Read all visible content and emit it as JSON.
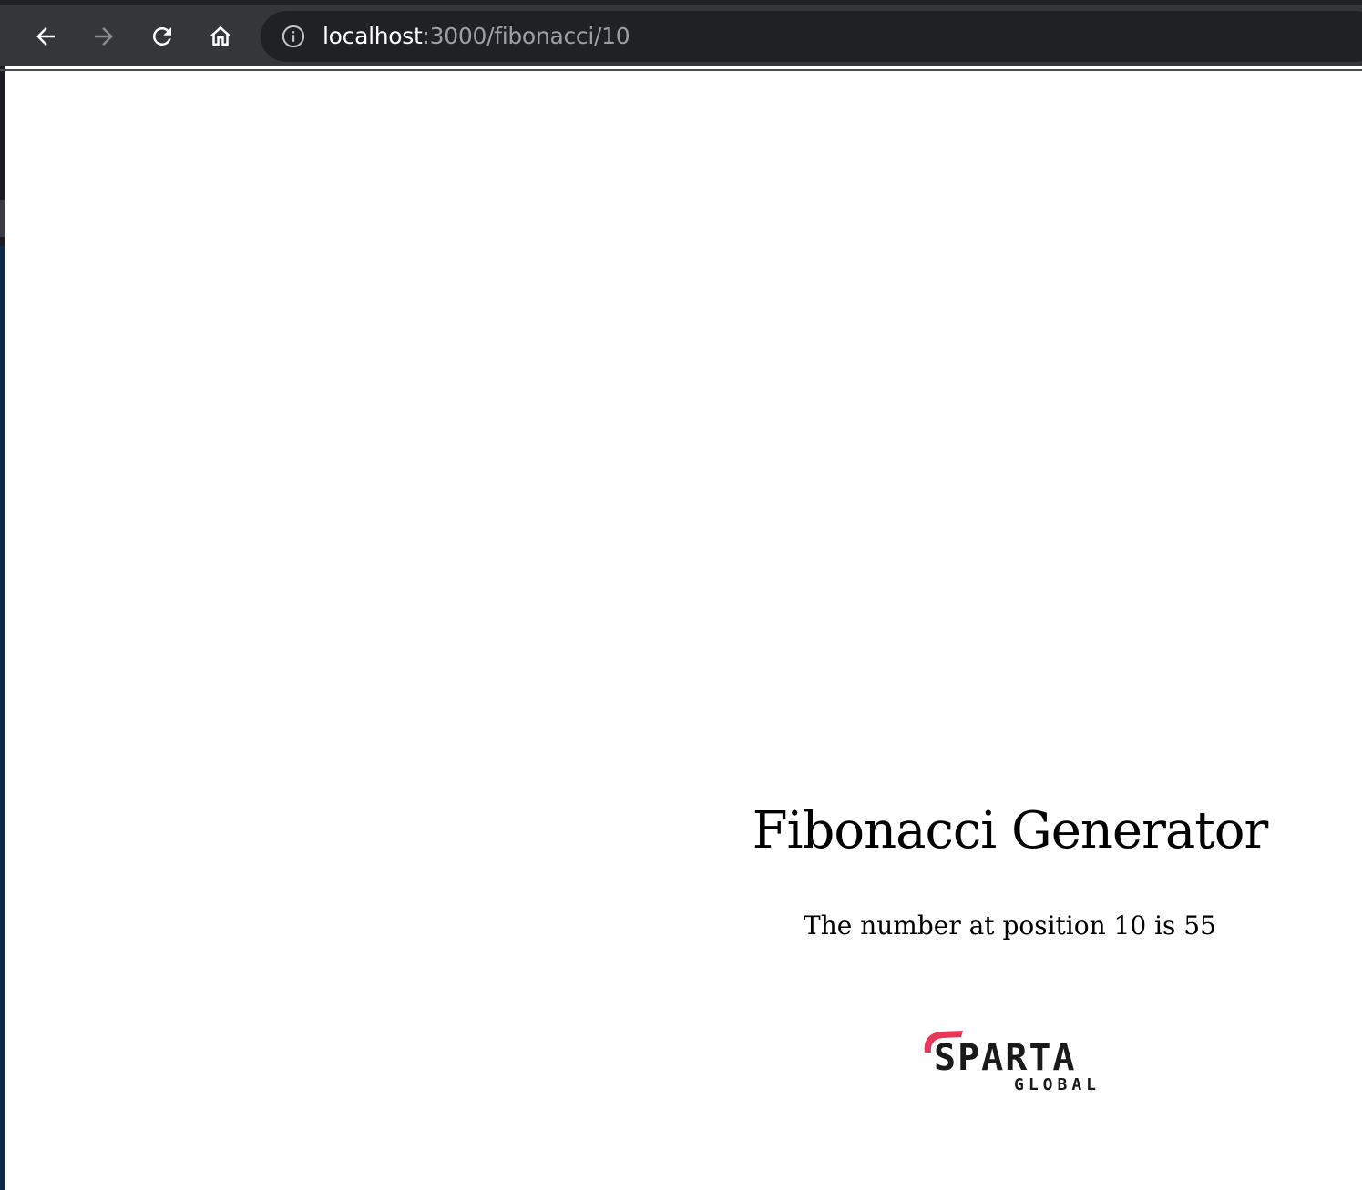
{
  "browser": {
    "url_host": "localhost",
    "url_path": ":3000/fibonacci/10"
  },
  "page": {
    "title": "Fibonacci Generator",
    "result": "The number at position 10 is 55"
  },
  "logo": {
    "main": "SPARTA",
    "sub": "GLOBAL",
    "accent_color": "#e8385a"
  },
  "colors": {
    "toolbar": "#35363a",
    "omnibox": "#202124",
    "url_host": "#ffffff",
    "url_path": "#9aa0a6"
  },
  "icons": {
    "back": "arrow-left-icon",
    "forward": "arrow-right-icon",
    "reload": "reload-icon",
    "home": "home-icon",
    "info": "info-icon"
  }
}
